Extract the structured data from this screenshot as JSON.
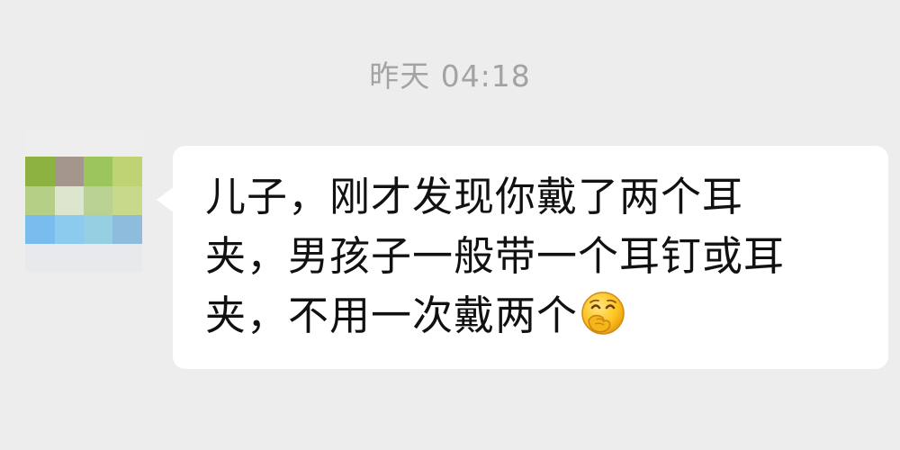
{
  "chat": {
    "timestamp": "昨天 04:18",
    "message": {
      "lines": [
        "儿子，刚才发现你戴了两个耳",
        "夹，男孩子一般带一个耳钉或耳",
        "夹，不用一次戴两个"
      ],
      "emoji": "giggle-face-emoji"
    },
    "sender_avatar": "pixelated-avatar"
  },
  "colors": {
    "background": "#ededed",
    "bubble": "#ffffff",
    "timestamp": "#a3a3a3",
    "text": "#111111"
  }
}
